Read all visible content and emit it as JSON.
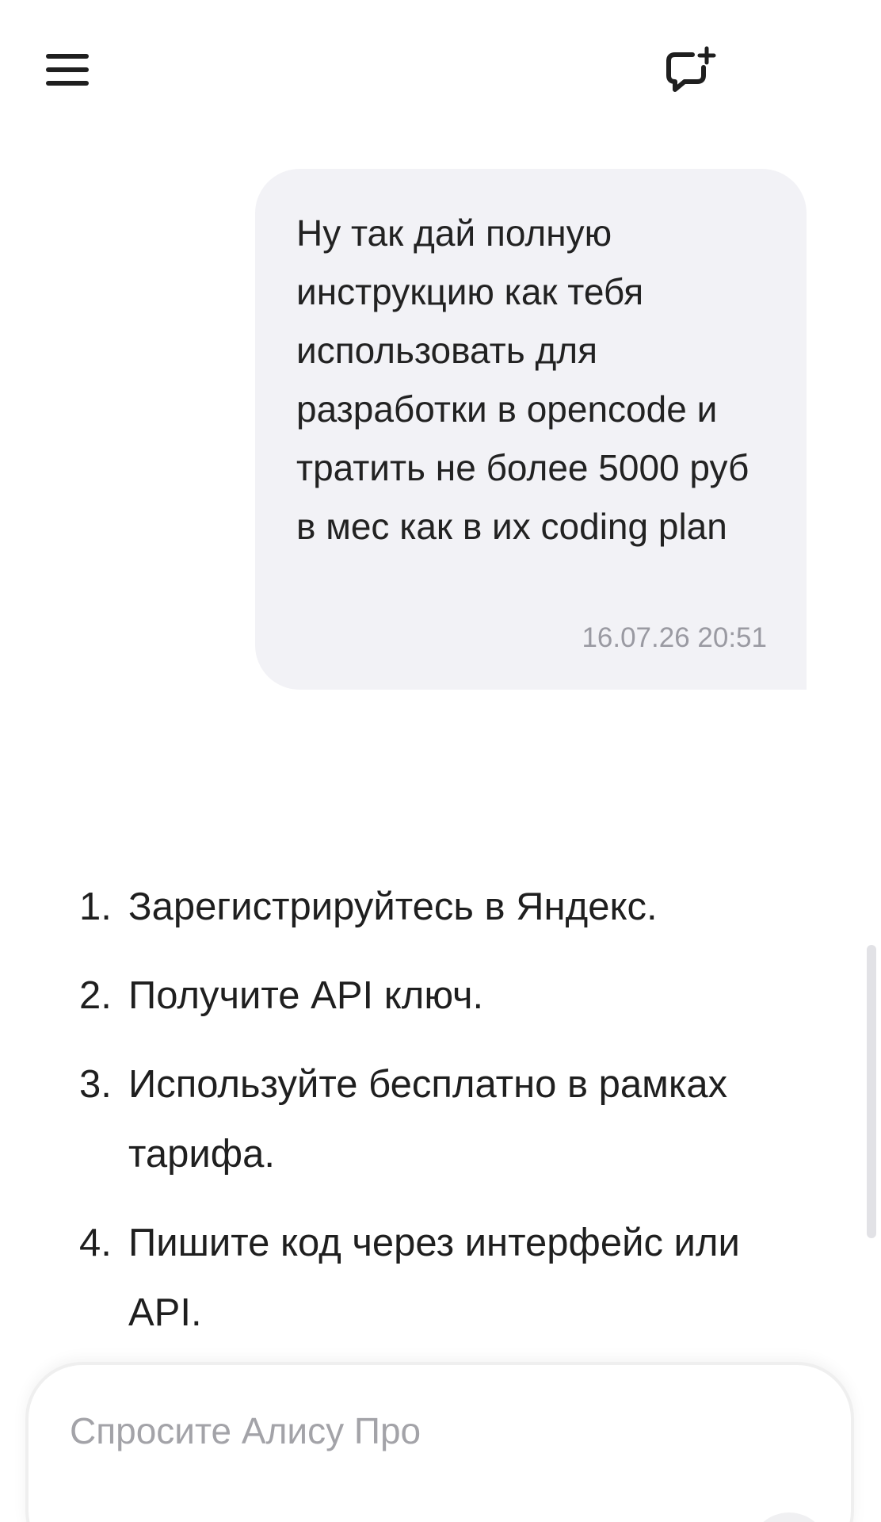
{
  "header": {
    "menu_icon": "hamburger-menu-icon",
    "new_chat_icon": "chat-bubble-plus-icon"
  },
  "message": {
    "text": "Ну так дай полную инструкцию как тебя использовать для разработки в opencode и тратить не более 5000 руб в мес как в их coding plan",
    "timestamp": "16.07.26 20:51"
  },
  "answer": {
    "items": [
      {
        "num": "1.",
        "text": "Зарегистрируйтесь в Яндекс."
      },
      {
        "num": "2.",
        "text": "Получите API ключ."
      },
      {
        "num": "3.",
        "text": "Используйте бесплатно в рамках тарифа."
      },
      {
        "num": "4.",
        "text": "Пишите код через интерфейс или API."
      }
    ]
  },
  "composer": {
    "placeholder": "Спросите Алису Про",
    "value": ""
  }
}
